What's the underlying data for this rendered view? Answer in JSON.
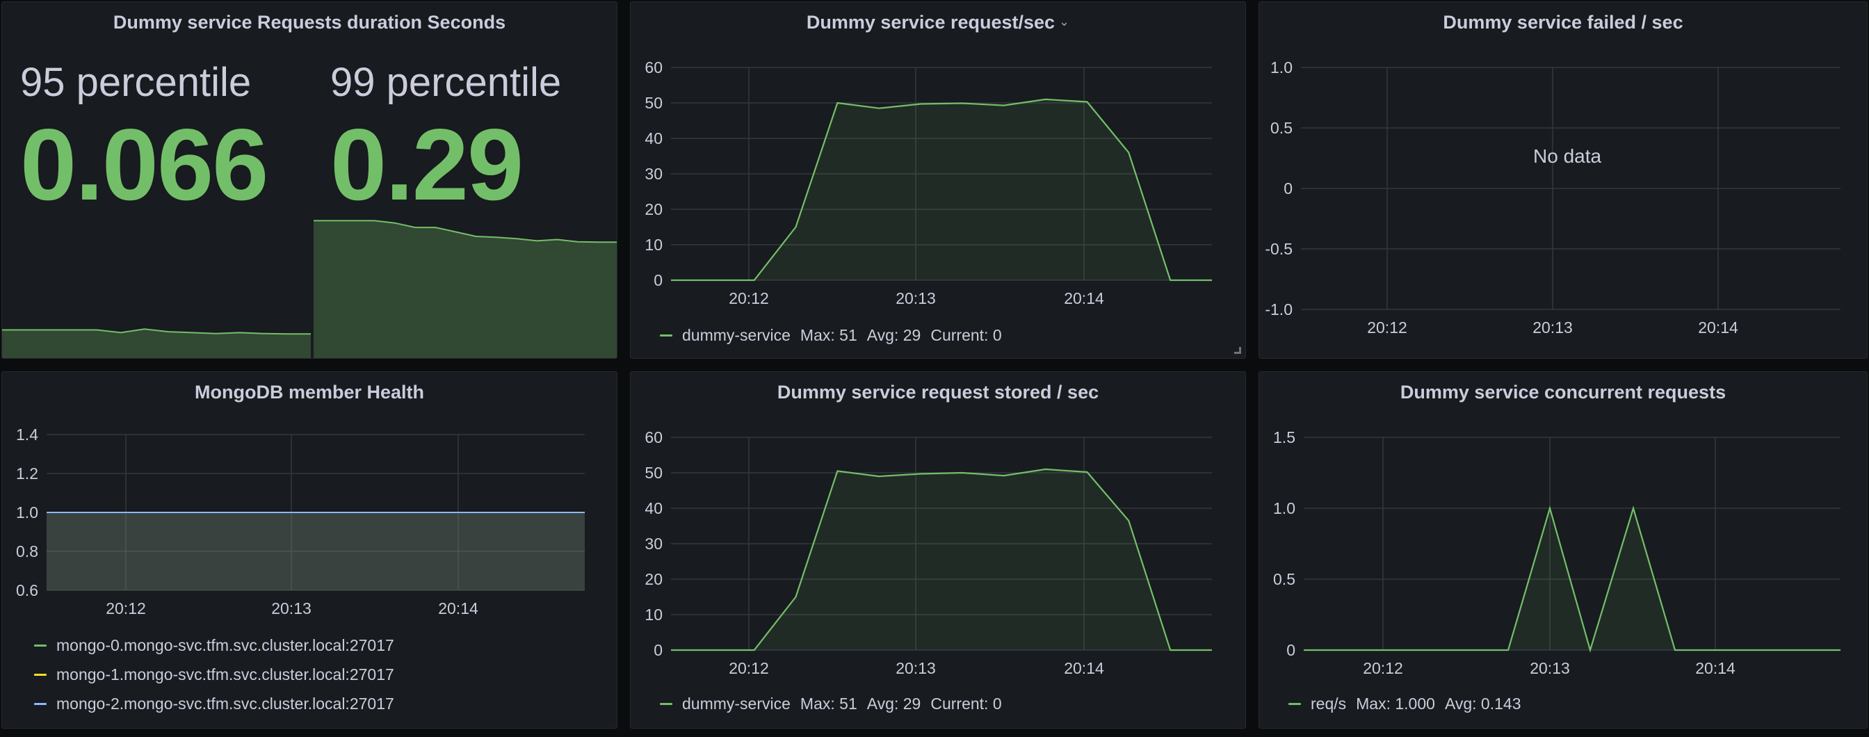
{
  "colors": {
    "green": "#73bf69",
    "yellow": "#fade2a",
    "blue": "#8ab8ff",
    "grid": "#34373d",
    "text": "#ccccdc"
  },
  "panels": {
    "duration": {
      "title": "Dummy service Requests duration Seconds"
    },
    "req_sec": {
      "title": "Dummy service request/sec",
      "title_icon": "chevron-down-icon"
    },
    "failed": {
      "title": "Dummy service failed / sec",
      "no_data": "No data"
    },
    "mongo": {
      "title": "MongoDB member Health"
    },
    "stored": {
      "title": "Dummy service request stored / sec"
    },
    "concurrent": {
      "title": "Dummy service concurrent requests"
    }
  },
  "chart_data": [
    {
      "id": "duration",
      "type": "stat",
      "title": "Dummy service Requests duration Seconds",
      "stats": [
        {
          "name": "95 percentile",
          "value": "0.066",
          "sparkline": [
            0.066,
            0.066,
            0.066,
            0.066,
            0.066,
            0.06,
            0.068,
            0.062,
            0.06,
            0.058,
            0.06,
            0.058,
            0.057,
            0.057
          ]
        },
        {
          "name": "99 percentile",
          "value": "0.29",
          "sparkline": [
            0.31,
            0.31,
            0.31,
            0.31,
            0.305,
            0.295,
            0.295,
            0.285,
            0.275,
            0.273,
            0.27,
            0.265,
            0.268,
            0.263,
            0.262,
            0.262
          ]
        }
      ],
      "sparkline_range": [
        0,
        0.32
      ]
    },
    {
      "id": "req_sec",
      "type": "line",
      "title": "Dummy service request/sec",
      "x": [
        "20:11:30",
        "20:11:45",
        "20:12:00",
        "20:12:15",
        "20:12:30",
        "20:12:45",
        "20:13:00",
        "20:13:15",
        "20:13:30",
        "20:13:45",
        "20:14:00",
        "20:14:15",
        "20:14:30",
        "20:14:45"
      ],
      "x_ticks": [
        "20:12",
        "20:13",
        "20:14"
      ],
      "y_ticks": [
        0,
        10,
        20,
        30,
        40,
        50,
        60
      ],
      "ylim": [
        0,
        60
      ],
      "series": [
        {
          "name": "dummy-service",
          "values": [
            0,
            0,
            0,
            15,
            50,
            48.5,
            49.7,
            49.9,
            49.3,
            51,
            50.3,
            36,
            0,
            0
          ]
        }
      ],
      "legend": {
        "name": "dummy-service",
        "stats": [
          "Max: 51",
          "Avg: 29",
          "Current: 0"
        ]
      }
    },
    {
      "id": "failed",
      "type": "line",
      "title": "Dummy service failed / sec",
      "x_ticks": [
        "20:12",
        "20:13",
        "20:14"
      ],
      "y_ticks": [
        "1.0",
        "0.5",
        "0",
        "-0.5",
        "-1.0"
      ],
      "ylim": [
        -1,
        1
      ],
      "series": []
    },
    {
      "id": "mongo",
      "type": "area",
      "title": "MongoDB member Health",
      "x_ticks": [
        "20:12",
        "20:13",
        "20:14"
      ],
      "y_ticks": [
        "0.6",
        "0.8",
        "1.0",
        "1.2",
        "1.4"
      ],
      "ylim": [
        0.6,
        1.4
      ],
      "series": [
        {
          "name": "mongo-0.mongo-svc.tfm.svc.cluster.local:27017",
          "values": [
            1,
            1
          ]
        },
        {
          "name": "mongo-1.mongo-svc.tfm.svc.cluster.local:27017",
          "values": [
            1,
            1
          ]
        },
        {
          "name": "mongo-2.mongo-svc.tfm.svc.cluster.local:27017",
          "values": [
            1,
            1
          ]
        }
      ]
    },
    {
      "id": "stored",
      "type": "line",
      "title": "Dummy service request stored / sec",
      "x_ticks": [
        "20:12",
        "20:13",
        "20:14"
      ],
      "y_ticks": [
        0,
        10,
        20,
        30,
        40,
        50,
        60
      ],
      "ylim": [
        0,
        60
      ],
      "series": [
        {
          "name": "dummy-service",
          "values": [
            0,
            0,
            0,
            15,
            50.5,
            49,
            49.7,
            50,
            49.2,
            51,
            50.2,
            36.5,
            0,
            0
          ]
        }
      ],
      "legend": {
        "name": "dummy-service",
        "stats": [
          "Max: 51",
          "Avg: 29",
          "Current: 0"
        ]
      }
    },
    {
      "id": "concurrent",
      "type": "line",
      "title": "Dummy service concurrent requests",
      "x_ticks": [
        "20:12",
        "20:13",
        "20:14"
      ],
      "y_ticks": [
        "0",
        "0.5",
        "1.0",
        "1.5"
      ],
      "ylim": [
        0,
        1.5
      ],
      "series": [
        {
          "name": "req/s",
          "values": [
            0,
            0,
            0,
            0,
            0,
            0,
            0,
            1,
            0,
            1,
            0,
            0,
            0,
            0,
            0,
            0
          ]
        }
      ],
      "legend": {
        "name": "req/s",
        "stats": [
          "Max: 1.000",
          "Avg: 0.143"
        ]
      }
    }
  ]
}
